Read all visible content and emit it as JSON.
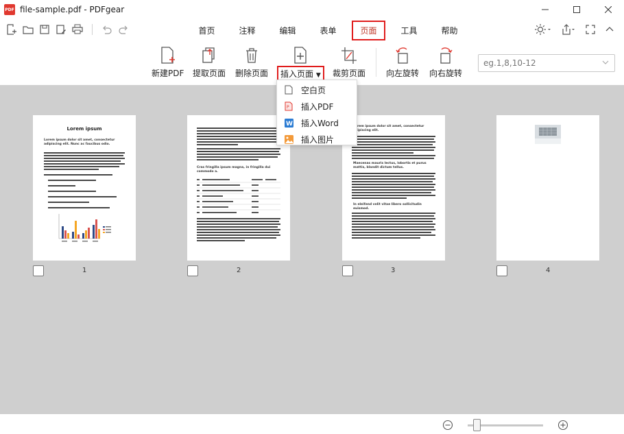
{
  "app": {
    "title": "file-sample.pdf - PDFgear",
    "logo_text": "PDF"
  },
  "menu": {
    "tabs": [
      {
        "label": "首页"
      },
      {
        "label": "注释"
      },
      {
        "label": "编辑"
      },
      {
        "label": "表单"
      },
      {
        "label": "页面"
      },
      {
        "label": "工具"
      },
      {
        "label": "帮助"
      }
    ],
    "active_tab": "页面"
  },
  "ribbon": {
    "new_pdf": "新建PDF",
    "extract_pages": "提取页面",
    "delete_pages": "删除页面",
    "insert_pages": "插入页面",
    "crop_pages": "裁剪页面",
    "rotate_left": "向左旋转",
    "rotate_right": "向右旋转",
    "page_range_placeholder": "eg.1,8,10-12"
  },
  "insert_menu": {
    "items": [
      {
        "label": "空白页",
        "icon": "blank-page-icon"
      },
      {
        "label": "插入PDF",
        "icon": "pdf-file-icon"
      },
      {
        "label": "插入Word",
        "icon": "word-file-icon"
      },
      {
        "label": "插入图片",
        "icon": "image-file-icon"
      }
    ]
  },
  "pages": [
    {
      "number": "1",
      "heading": "Lorem ipsum",
      "subheading": "Lorem ipsum dolor sit amet, consectetur adipiscing elit. Nunc ac faucibus odio."
    },
    {
      "number": "2",
      "heading": "Cras fringilla ipsum magna, in fringilla dui commodo a."
    },
    {
      "number": "3",
      "heading": "Lorem ipsum dolor sit amet, consectetur adipiscing elit.",
      "heading2": "Maecenas mauris lectus, lobortis et purus mattis, blandit dictum tellus.",
      "heading3": "In eleifend velit vitae libero sollicitudin euismod."
    },
    {
      "number": "4"
    }
  ],
  "colors": {
    "accent_red": "#e01b1b",
    "workspace_bg": "#cfcfcf",
    "chart_blue": "#2e4a87",
    "chart_orange": "#f5a623",
    "chart_red": "#d9534f"
  }
}
